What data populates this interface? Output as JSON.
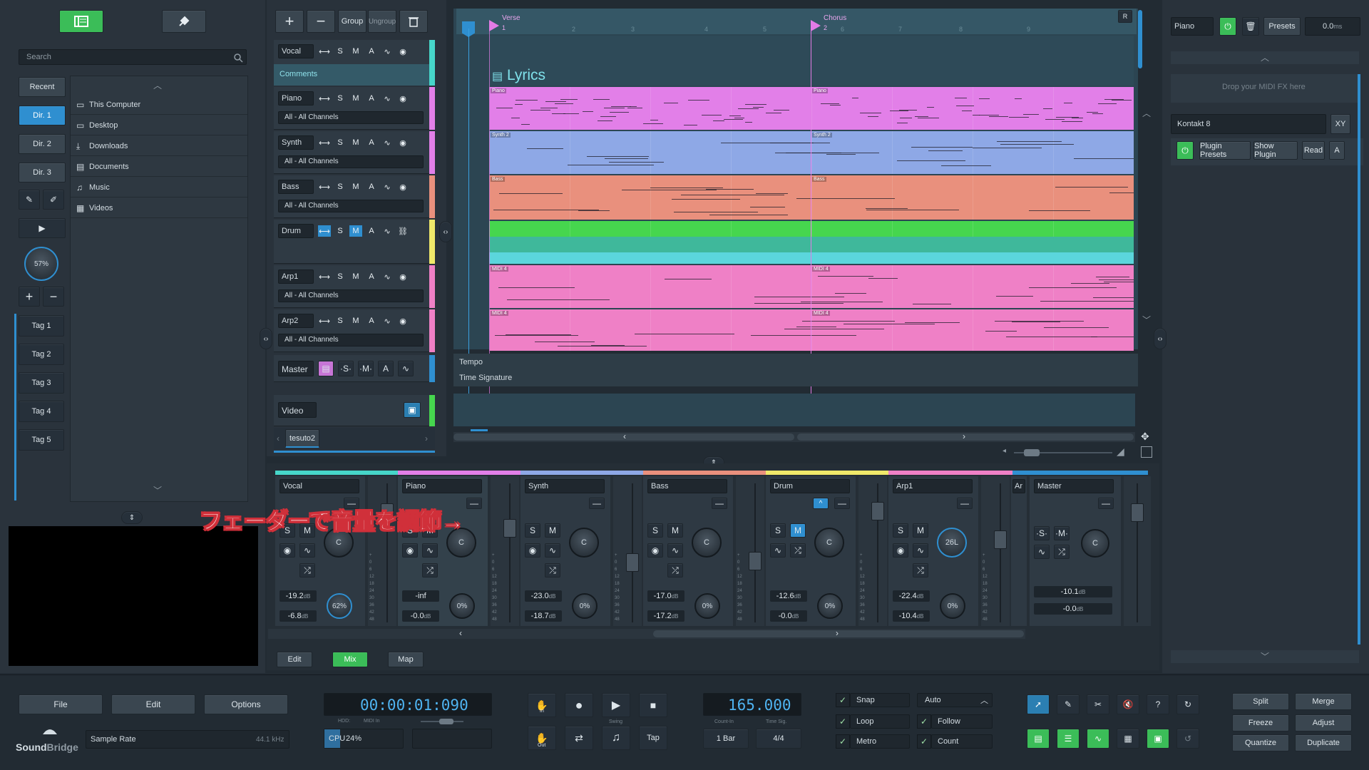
{
  "browser": {
    "search_placeholder": "Search",
    "recent": "Recent",
    "dirs": [
      "Dir. 1",
      "Dir. 2",
      "Dir. 3"
    ],
    "zoom": "57%",
    "tags": [
      "Tag 1",
      "Tag 2",
      "Tag 3",
      "Tag 4",
      "Tag 5"
    ],
    "locations": [
      "This Computer",
      "Desktop",
      "Downloads",
      "Documents",
      "Music",
      "Videos"
    ]
  },
  "tracks_toolbar": {
    "group": "Group",
    "ungroup": "Ungroup"
  },
  "tracks": [
    {
      "name": "Vocal",
      "sub": "Comments"
    },
    {
      "name": "Piano",
      "sub": "All - All Channels"
    },
    {
      "name": "Synth",
      "sub": "All - All Channels"
    },
    {
      "name": "Bass",
      "sub": "All - All Channels"
    },
    {
      "name": "Drum",
      "sub": ""
    },
    {
      "name": "Arp1",
      "sub": "All - All Channels"
    },
    {
      "name": "Arp2",
      "sub": "All - All Channels"
    }
  ],
  "track_buttons": {
    "s": "S",
    "m": "M",
    "a": "A"
  },
  "master_track": "Master",
  "video_track": "Video",
  "project_tab": "tesuto2",
  "arrange": {
    "markers": [
      {
        "name": "Verse",
        "num": "1"
      },
      {
        "name": "Chorus",
        "num": "2"
      }
    ],
    "bar_numbers": [
      "2",
      "3",
      "4",
      "5",
      "6",
      "7",
      "8",
      "9"
    ],
    "lyrics": "Lyrics",
    "r_button": "R",
    "clips": [
      "Piano",
      "Synth 2",
      "Bass",
      "MIDI 4",
      "MIDI 4"
    ],
    "clips2": [
      "Piano",
      "Synth 2",
      "Bass",
      "Arp",
      "MIDI 4"
    ],
    "tempo": "Tempo",
    "time_signature": "Time Signature"
  },
  "colors": {
    "piano": "#e27fe8",
    "synth": "#8ea8e6",
    "bass": "#e9907d",
    "drum": "#46d64e",
    "arp": "#ef80c6",
    "accent_green": "#3bbd58",
    "accent_blue": "#2f8fd0"
  },
  "mixer": {
    "channels": [
      {
        "name": "Vocal",
        "vol": "-19.2",
        "vol_unit": "dB",
        "pk": "-6.8",
        "pk_unit": "dB",
        "pan": "C",
        "send": "62%"
      },
      {
        "name": "Piano",
        "vol": "-inf",
        "vol_unit": "",
        "pk": "-0.0",
        "pk_unit": "dB",
        "pan": "C",
        "send": "0%"
      },
      {
        "name": "Synth",
        "vol": "-23.0",
        "vol_unit": "dB",
        "pk": "-18.7",
        "pk_unit": "dB",
        "pan": "C",
        "send": "0%"
      },
      {
        "name": "Bass",
        "vol": "-17.0",
        "vol_unit": "dB",
        "pk": "-17.2",
        "pk_unit": "dB",
        "pan": "C",
        "send": "0%"
      },
      {
        "name": "Drum",
        "vol": "-12.6",
        "vol_unit": "dB",
        "pk": "-0.0",
        "pk_unit": "dB",
        "pan": "C",
        "send": "0%"
      },
      {
        "name": "Arp1",
        "vol": "-22.4",
        "vol_unit": "dB",
        "pk": "-10.4",
        "pk_unit": "dB",
        "pan": "26L",
        "send": "0%"
      }
    ],
    "partial": "Ar",
    "master": {
      "name": "Master",
      "vol": "-10.1",
      "vol_unit": "dB",
      "pk": "-0.0",
      "pk_unit": "dB",
      "pan": "C"
    },
    "overlay": "フェーダーで音量を調節→",
    "scale": [
      "+",
      "0",
      "6",
      "12",
      "18",
      "24",
      "30",
      "36",
      "42",
      "48"
    ]
  },
  "view_tabs": [
    "Edit",
    "Mix",
    "Map"
  ],
  "fx": {
    "track": "Piano",
    "presets": "Presets",
    "gain": "0.0",
    "gain_unit": "ms",
    "drop": "Drop your MIDI FX here",
    "plugin": "Kontakt 8",
    "xy": "XY",
    "plugin_presets": "Plugin Presets",
    "show_plugin": "Show Plugin",
    "read": "Read",
    "a": "A"
  },
  "transport": {
    "file": "File",
    "edit": "Edit",
    "options": "Options",
    "time": "00:00:01:090",
    "hdd": "HDD:",
    "midi_in": "MIDI In",
    "swing": "Swing",
    "in": "In",
    "out": "Out",
    "tap": "Tap",
    "tempo": "165.000",
    "count_in": "Count-In",
    "count_val": "1 Bar",
    "time_sig": "Time Sig.",
    "sig_val": "4/4",
    "sample_rate": "Sample Rate",
    "rate_val": "44.1 kHz",
    "cpu": "CPU",
    "cpu_val": "24%",
    "snap": "Snap",
    "loop": "Loop",
    "metro": "Metro",
    "auto": "Auto",
    "follow": "Follow",
    "count": "Count",
    "split": "Split",
    "merge": "Merge",
    "freeze": "Freeze",
    "adjust": "Adjust",
    "quantize": "Quantize",
    "duplicate": "Duplicate",
    "brand1": "Sound",
    "brand2": "Bridge"
  }
}
